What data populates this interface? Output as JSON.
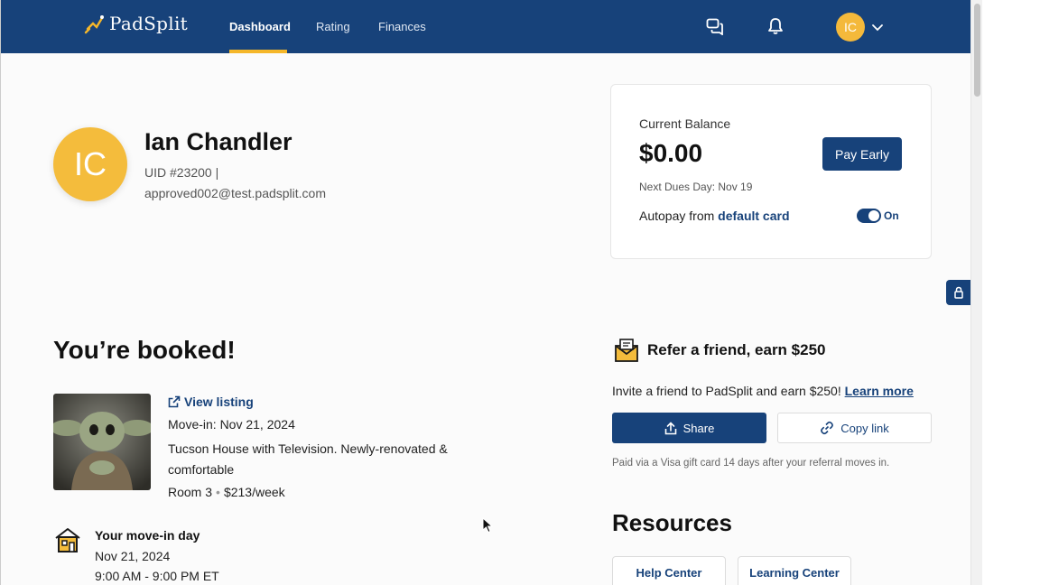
{
  "nav": {
    "logo_text": "PadSplit",
    "links": [
      {
        "label": "Dashboard",
        "active": true
      },
      {
        "label": "Rating",
        "active": false
      },
      {
        "label": "Finances",
        "active": false
      }
    ],
    "icons": [
      "messages-icon",
      "bell-icon"
    ],
    "avatar_initials": "IC",
    "accent_color": "#f5b72a",
    "bar_color": "#17427a"
  },
  "profile": {
    "initials": "IC",
    "name": "Ian Chandler",
    "uid": "UID #23200 |",
    "email": "approved002@test.padsplit.com"
  },
  "balance": {
    "label": "Current Balance",
    "amount": "$0.00",
    "pay_early_label": "Pay Early",
    "next_dues": "Next Dues Day: Nov 19",
    "autopay_prefix": "Autopay from ",
    "autopay_link": "default card",
    "toggle_label": "On"
  },
  "booking": {
    "title": "You’re booked!",
    "view_listing": "View listing",
    "move_in": "Move-in: Nov 21, 2024",
    "description": "Tucson House with Television. Newly-renovated & comfortable",
    "room": "Room 3",
    "price": "$213/week",
    "movein_day_title": "Your move-in day",
    "movein_day_date": "Nov 21, 2024",
    "movein_day_time": "9:00 AM - 9:00 PM ET"
  },
  "referral": {
    "title": "Refer a friend, earn $250",
    "description": "Invite a friend to PadSplit and earn $250! ",
    "learn_more": "Learn more",
    "share_label": "Share",
    "copy_label": "Copy link",
    "note": "Paid via a Visa gift card 14 days after your referral moves in."
  },
  "resources": {
    "title": "Resources",
    "items": [
      "Help Center",
      "Learning Center"
    ]
  }
}
